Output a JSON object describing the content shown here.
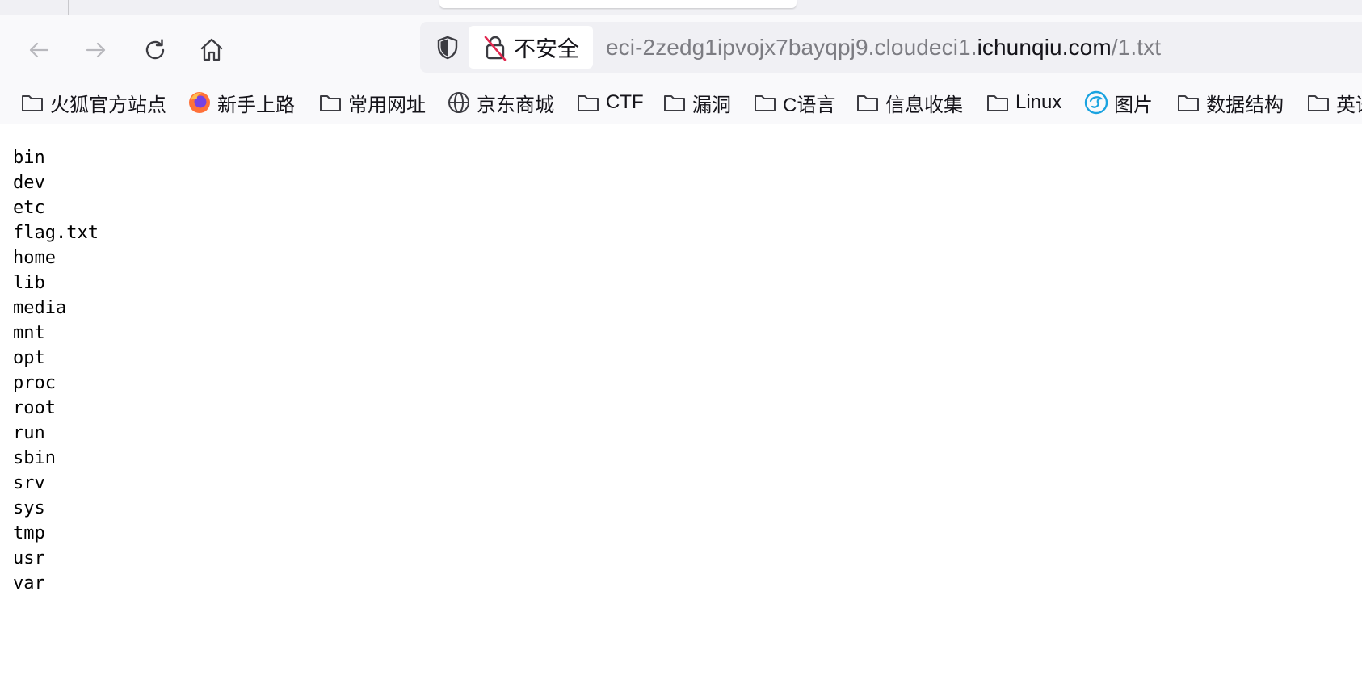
{
  "browser": {
    "url_security_label": "不安全",
    "url": {
      "prefix": "eci-2zedg1ipvojx7bayqpj9.cloudeci1.",
      "domain": "ichunqiu.com",
      "suffix": "/1.txt"
    }
  },
  "bookmarks": [
    {
      "label": "火狐官方站点",
      "icon": "folder-icon"
    },
    {
      "label": "新手上路",
      "icon": "firefox-icon"
    },
    {
      "label": "常用网址",
      "icon": "folder-icon"
    },
    {
      "label": "京东商城",
      "icon": "globe-icon"
    },
    {
      "label": "CTF",
      "icon": "folder-icon"
    },
    {
      "label": "漏洞",
      "icon": "folder-icon"
    },
    {
      "label": "C语言",
      "icon": "folder-icon"
    },
    {
      "label": "信息收集",
      "icon": "folder-icon"
    },
    {
      "label": "Linux",
      "icon": "folder-icon"
    },
    {
      "label": "图片",
      "icon": "picture-site-icon"
    },
    {
      "label": "数据结构",
      "icon": "folder-icon"
    },
    {
      "label": "英语",
      "icon": "folder-icon"
    }
  ],
  "file_lines": [
    "bin",
    "dev",
    "etc",
    "flag.txt",
    "home",
    "lib",
    "media",
    "mnt",
    "opt",
    "proc",
    "root",
    "run",
    "sbin",
    "srv",
    "sys",
    "tmp",
    "usr",
    "var"
  ],
  "colors": {
    "toolbar_bg": "#f9f9fb",
    "urlbar_bg": "#f0f0f4",
    "insecure_slash": "#e22850",
    "firefox_orange": "#ff7139",
    "picture_icon_blue": "#1aa3e0"
  }
}
